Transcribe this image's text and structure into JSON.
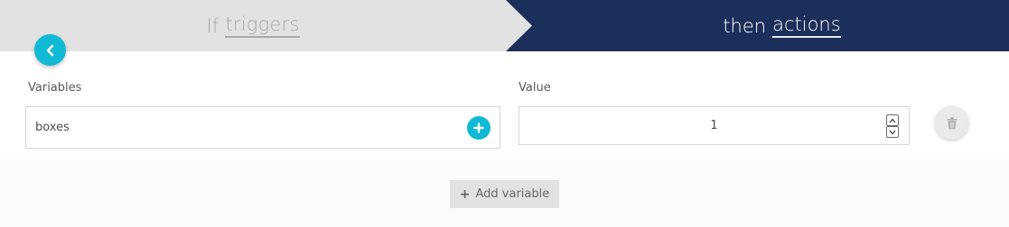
{
  "steps": {
    "if": {
      "word": "If",
      "emphasis": "triggers"
    },
    "then": {
      "word": "then",
      "emphasis": "actions"
    }
  },
  "form": {
    "variables_label": "Variables",
    "value_label": "Value",
    "variable_value": "boxes",
    "value_value": "1"
  },
  "footer": {
    "add_variable_plus": "+",
    "add_variable_label": "Add variable"
  },
  "icons": {
    "back": "chevron-left-icon",
    "add": "plus-icon",
    "delete": "trash-icon",
    "spinner_up": "chevron-up-icon",
    "spinner_down": "chevron-down-icon"
  },
  "colors": {
    "accent": "#10b9d4",
    "navy": "#1c2f5a",
    "header_bg": "#e2e2e2"
  }
}
